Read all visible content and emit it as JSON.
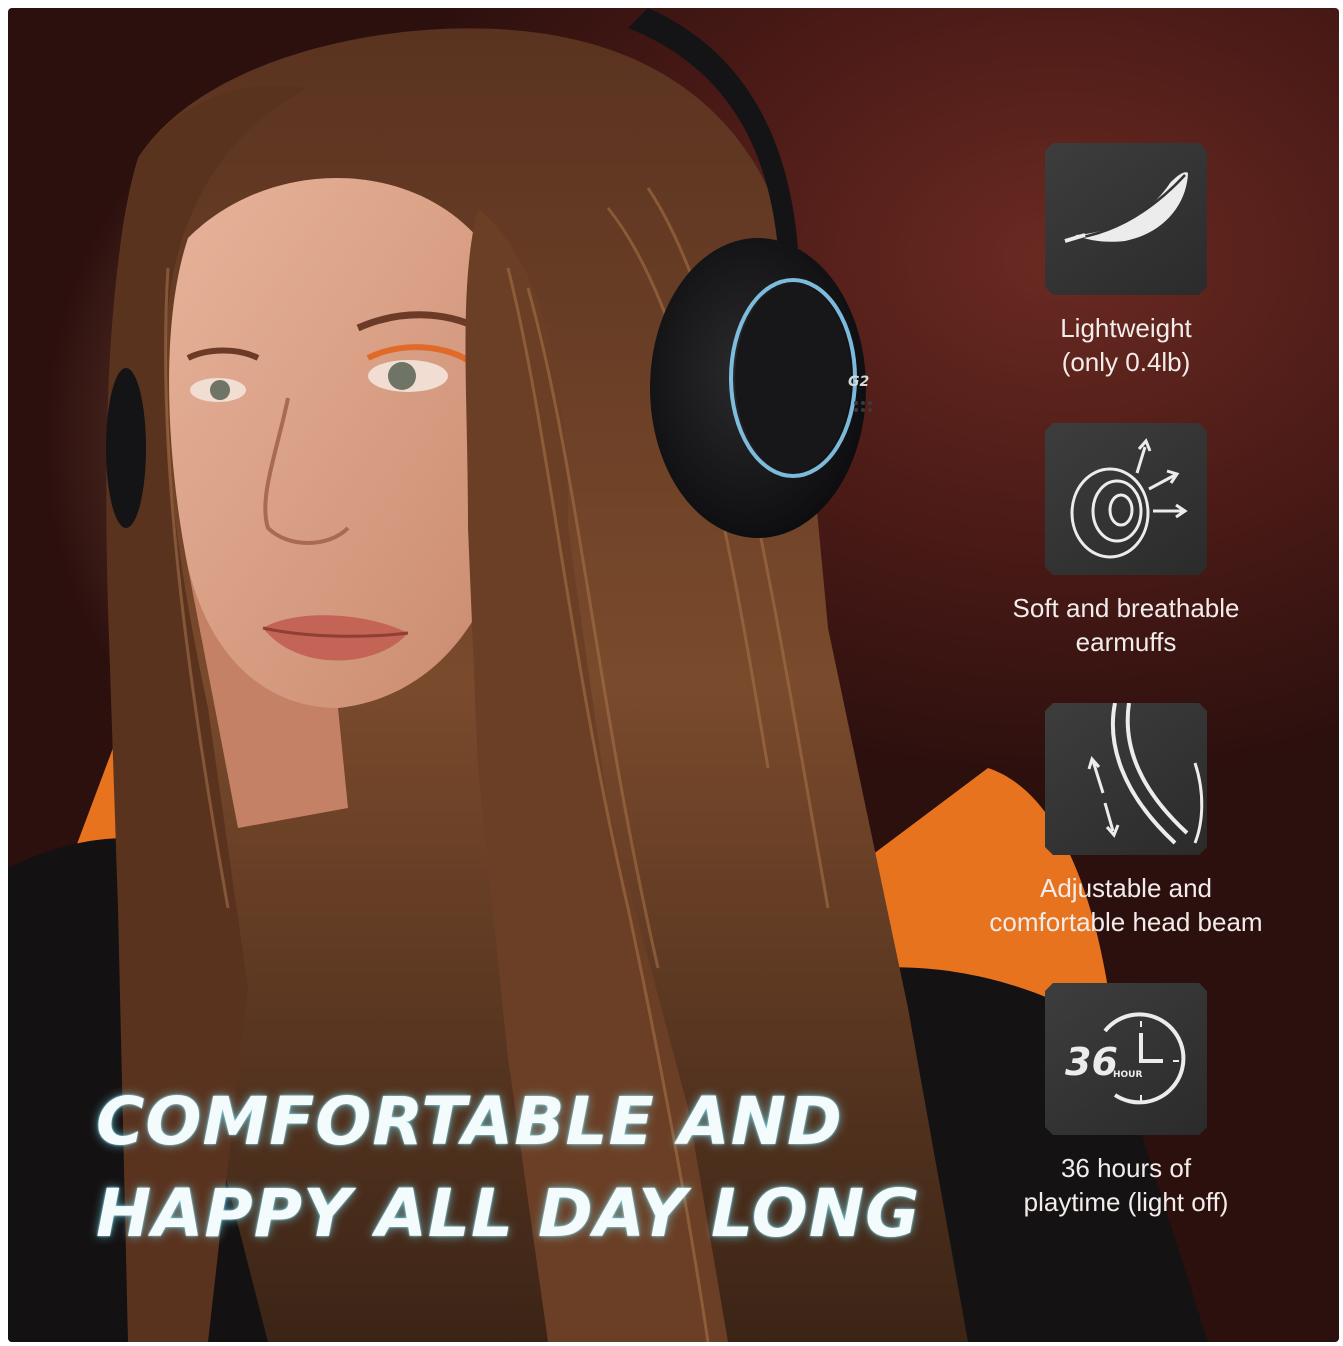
{
  "headline": {
    "line1": "COMFORTABLE AND",
    "line2": "HAPPY ALL DAY LONG"
  },
  "headphone_badge": "G2",
  "features": [
    {
      "icon": "feather-icon",
      "line1": "Lightweight",
      "line2": "(only 0.4lb)"
    },
    {
      "icon": "earmuff-icon",
      "line1": "Soft and breathable",
      "line2": "earmuffs"
    },
    {
      "icon": "head-beam-icon",
      "line1": "Adjustable and",
      "line2": "comfortable head beam"
    },
    {
      "icon": "playtime-clock-icon",
      "line1": "36 hours of",
      "line2": "playtime (light off)",
      "icon_number": "36",
      "icon_unit": "HOUR"
    }
  ],
  "colors": {
    "background": "#4a1a16",
    "hoodie_orange": "#e8731f",
    "headline_glow": "#9ff0ff",
    "icon_box": "#363636",
    "caption_text": "#f2ecea",
    "headphone_ring": "#8fd8ff"
  }
}
